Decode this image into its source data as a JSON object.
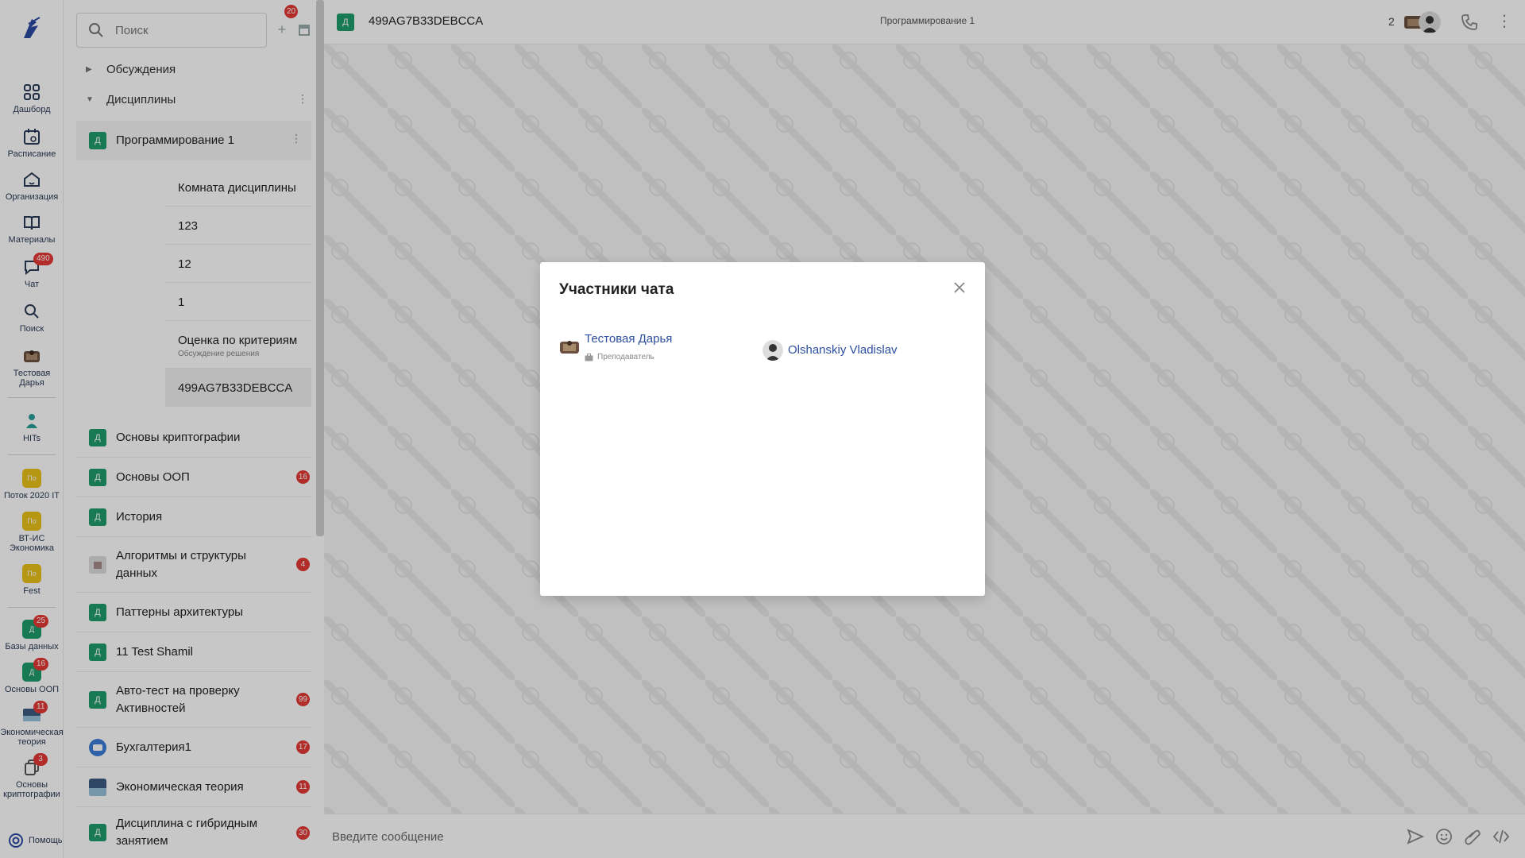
{
  "rail": {
    "items": [
      {
        "label": "Дашборд",
        "icon": "dashboard-icon"
      },
      {
        "label": "Расписание",
        "icon": "calendar-icon"
      },
      {
        "label": "Организация",
        "icon": "home-icon"
      },
      {
        "label": "Материалы",
        "icon": "book-icon"
      },
      {
        "label": "Чат",
        "icon": "chat-icon",
        "badge": "490"
      },
      {
        "label": "Поиск",
        "icon": "search-icon"
      },
      {
        "label": "Тестовая Дарья",
        "icon": "avatar"
      }
    ],
    "hits_label": "HITs",
    "groups": [
      {
        "label": "Поток 2020 IT",
        "abbr": "По"
      },
      {
        "label": "ВТ-ИС Экономика",
        "abbr": "По"
      },
      {
        "label": "Fest",
        "abbr": "По"
      }
    ],
    "recent": [
      {
        "label": "Базы данных",
        "abbr": "Д",
        "badge": "25"
      },
      {
        "label": "Основы ООП",
        "abbr": "Д",
        "badge": "16"
      },
      {
        "label": "Экономическая теория",
        "badge": "11"
      },
      {
        "label": "Основы криптографии",
        "badge": "3"
      }
    ],
    "help_label": "Помощь"
  },
  "channel_list": {
    "search_placeholder": "Поиск",
    "sections": {
      "discussions": {
        "label": "Обсуждения",
        "badge": "20"
      },
      "disciplines": {
        "label": "Дисциплины"
      }
    },
    "expanded": {
      "abbr": "Д",
      "label": "Программирование 1",
      "rooms": [
        {
          "label": "Комната дисциплины"
        },
        {
          "label": "123"
        },
        {
          "label": "12"
        },
        {
          "label": "1"
        },
        {
          "label": "Оценка по критериям",
          "sublabel": "Обсуждение решения"
        },
        {
          "label": "499AG7B33DEBCCA"
        }
      ]
    },
    "disciplines": [
      {
        "abbr": "Д",
        "label": "Основы криптографии",
        "badge": ""
      },
      {
        "abbr": "Д",
        "label": "Основы ООП",
        "badge": "16"
      },
      {
        "abbr": "Д",
        "label": "История",
        "badge": ""
      },
      {
        "abbr": "",
        "label": "Алгоритмы и структуры данных",
        "badge": "4"
      },
      {
        "abbr": "Д",
        "label": "Паттерны архитектуры",
        "badge": ""
      },
      {
        "abbr": "Д",
        "label": "11 Test Shamil",
        "badge": ""
      },
      {
        "abbr": "Д",
        "label": "Авто-тест на проверку Активностей",
        "badge": "99"
      },
      {
        "abbr": "",
        "label": "Бухгалтерия1",
        "badge": "17"
      },
      {
        "abbr": "",
        "label": "Экономическая теория",
        "badge": "11"
      },
      {
        "abbr": "Д",
        "label": "Дисциплина с гибридным занятием",
        "badge": "30"
      }
    ]
  },
  "chat": {
    "room_abbr": "Д",
    "room_title": "499AG7B33DEBCCA",
    "header_center": "Программирование 1",
    "participant_count": "2",
    "composer_placeholder": "Введите сообщение"
  },
  "modal": {
    "title": "Участники чата",
    "members": [
      {
        "name": "Тестовая Дарья",
        "role": "Преподаватель"
      },
      {
        "name": "Olshanskiy Vladislav",
        "role": ""
      }
    ]
  },
  "colors": {
    "discipline_green": "#1f9d6c",
    "badge_red": "#e53935",
    "link_blue": "#2d4fa0",
    "group_yellow": "#e8c21a"
  }
}
